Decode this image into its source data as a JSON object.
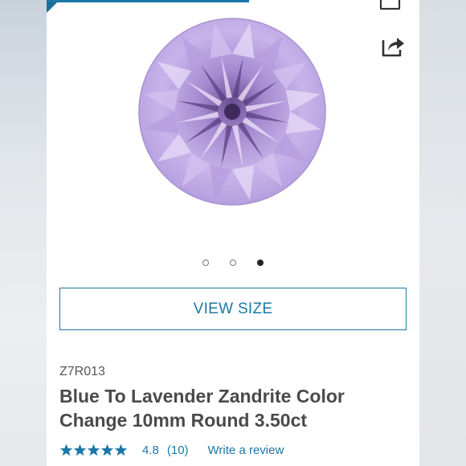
{
  "product": {
    "sku": "Z7R013",
    "title_line1": "Blue To Lavender Zandrite Color",
    "title_line2": "Change 10mm Round 3.50ct"
  },
  "gallery": {
    "dots": [
      "inactive",
      "inactive",
      "active"
    ],
    "gem_color": "#c4aee6"
  },
  "buttons": {
    "view_size": "VIEW SIZE"
  },
  "rating": {
    "stars": 5,
    "value": "4.8",
    "count": "(10)",
    "write_review": "Write a review"
  },
  "icons": {
    "share": "share-icon",
    "wishlist": "wishlist-icon"
  },
  "colors": {
    "accent": "#1a78a8",
    "title": "#4a4a4a"
  }
}
